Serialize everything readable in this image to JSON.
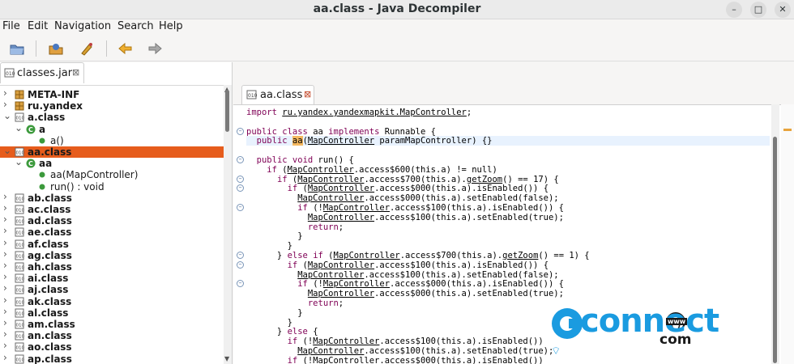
{
  "window": {
    "title": "aa.class - Java Decompiler",
    "controls": [
      "–",
      "□",
      "✕"
    ]
  },
  "menu": [
    "File",
    "Edit",
    "Navigation",
    "Search",
    "Help"
  ],
  "toolbar": {
    "icons": [
      "open-file-icon",
      "open-type-icon",
      "search-icon",
      "back-arrow-icon",
      "forward-arrow-icon"
    ]
  },
  "left_tab": {
    "label": "classes.jar"
  },
  "tree": [
    {
      "label": "META-INF",
      "twisty": ">",
      "icon": "package-icon",
      "bold": true
    },
    {
      "label": "ru.yandex",
      "twisty": ">",
      "icon": "package-icon",
      "bold": true
    },
    {
      "label": "a.class",
      "twisty": "v",
      "icon": "class-file-icon",
      "bold": true
    },
    {
      "label": "a",
      "twisty": "v",
      "icon": "class-icon",
      "bold": true
    },
    {
      "label": "a()",
      "twisty": "",
      "icon": "method-icon",
      "bold": false
    },
    {
      "label": "aa.class",
      "twisty": "v",
      "icon": "class-file-icon",
      "bold": true,
      "selected": true
    },
    {
      "label": "aa",
      "twisty": "v",
      "icon": "class-icon",
      "bold": true
    },
    {
      "label": "aa(MapController)",
      "twisty": "",
      "icon": "method-icon",
      "bold": false
    },
    {
      "label": "run() : void",
      "twisty": "",
      "icon": "method-icon",
      "bold": false
    },
    {
      "label": "ab.class",
      "twisty": ">",
      "icon": "class-file-icon",
      "bold": true
    },
    {
      "label": "ac.class",
      "twisty": ">",
      "icon": "class-file-icon",
      "bold": true
    },
    {
      "label": "ad.class",
      "twisty": ">",
      "icon": "class-file-icon",
      "bold": true
    },
    {
      "label": "ae.class",
      "twisty": ">",
      "icon": "class-file-icon",
      "bold": true
    },
    {
      "label": "af.class",
      "twisty": ">",
      "icon": "class-file-icon",
      "bold": true
    },
    {
      "label": "ag.class",
      "twisty": ">",
      "icon": "class-file-icon",
      "bold": true
    },
    {
      "label": "ah.class",
      "twisty": ">",
      "icon": "class-file-icon",
      "bold": true
    },
    {
      "label": "ai.class",
      "twisty": ">",
      "icon": "class-file-icon",
      "bold": true
    },
    {
      "label": "aj.class",
      "twisty": ">",
      "icon": "class-file-icon",
      "bold": true
    },
    {
      "label": "ak.class",
      "twisty": ">",
      "icon": "class-file-icon",
      "bold": true
    },
    {
      "label": "al.class",
      "twisty": ">",
      "icon": "class-file-icon",
      "bold": true
    },
    {
      "label": "am.class",
      "twisty": ">",
      "icon": "class-file-icon",
      "bold": true
    },
    {
      "label": "an.class",
      "twisty": ">",
      "icon": "class-file-icon",
      "bold": true
    },
    {
      "label": "ao.class",
      "twisty": ">",
      "icon": "class-file-icon",
      "bold": true
    },
    {
      "label": "ap.class",
      "twisty": ">",
      "icon": "class-file-icon",
      "bold": true
    }
  ],
  "editor_tab": {
    "label": "aa.class"
  },
  "code": [
    {
      "text": "import ru.yandex.yandexmapkit.MapController;",
      "fold": false
    },
    {
      "text": "",
      "fold": false
    },
    {
      "text": "public class aa implements Runnable {",
      "fold": true
    },
    {
      "text": "  public aa(MapController paramMapController) {}",
      "fold": false,
      "highlight": true
    },
    {
      "text": "",
      "fold": false
    },
    {
      "text": "  public void run() {",
      "fold": true
    },
    {
      "text": "    if (MapController.access$600(this.a) != null)",
      "fold": false
    },
    {
      "text": "      if (MapController.access$700(this.a).getZoom() == 17) {",
      "fold": true
    },
    {
      "text": "        if (MapController.access$000(this.a).isEnabled()) {",
      "fold": true
    },
    {
      "text": "          MapController.access$000(this.a).setEnabled(false);",
      "fold": false
    },
    {
      "text": "          if (!MapController.access$100(this.a).isEnabled()) {",
      "fold": true
    },
    {
      "text": "            MapController.access$100(this.a).setEnabled(true);",
      "fold": false
    },
    {
      "text": "            return;",
      "fold": false
    },
    {
      "text": "          }",
      "fold": false
    },
    {
      "text": "        }",
      "fold": false
    },
    {
      "text": "      } else if (MapController.access$700(this.a).getZoom() == 1) {",
      "fold": true
    },
    {
      "text": "        if (MapController.access$100(this.a).isEnabled()) {",
      "fold": true
    },
    {
      "text": "          MapController.access$100(this.a).setEnabled(false);",
      "fold": false
    },
    {
      "text": "          if (!MapController.access$000(this.a).isEnabled()) {",
      "fold": true
    },
    {
      "text": "            MapController.access$000(this.a).setEnabled(true);",
      "fold": false
    },
    {
      "text": "            return;",
      "fold": false
    },
    {
      "text": "          }",
      "fold": false
    },
    {
      "text": "        }",
      "fold": false
    },
    {
      "text": "      } else {",
      "fold": false
    },
    {
      "text": "        if (!MapController.access$100(this.a).isEnabled())",
      "fold": false
    },
    {
      "text": "          MapController.access$100(this.a).setEnabled(true);",
      "fold": false
    },
    {
      "text": "        if (!MapController.access$000(this.a).isEnabled())",
      "fold": false
    }
  ],
  "watermark": {
    "brand": "connect",
    "suffix": "com",
    "www": "www"
  },
  "colors": {
    "selection": "#e65c1c",
    "keyword": "#7f0055",
    "highlight_line": "#e8f2fe",
    "logo_blue": "#1a9be0"
  }
}
